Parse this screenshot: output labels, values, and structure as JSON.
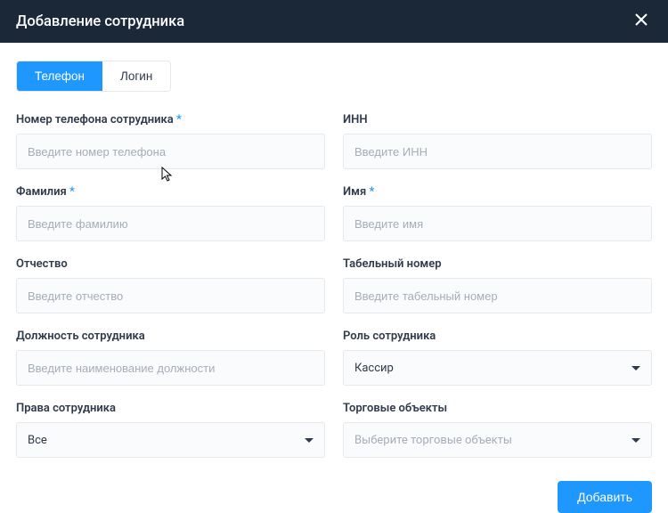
{
  "header": {
    "title": "Добавление сотрудника"
  },
  "tabs": {
    "phone": "Телефон",
    "login": "Логин"
  },
  "fields": {
    "phone": {
      "label": "Номер телефона сотрудника",
      "placeholder": "Введите номер телефона",
      "required": true
    },
    "inn": {
      "label": "ИНН",
      "placeholder": "Введите ИНН",
      "required": false
    },
    "lastname": {
      "label": "Фамилия",
      "placeholder": "Введите фамилию",
      "required": true
    },
    "firstname": {
      "label": "Имя",
      "placeholder": "Введите имя",
      "required": true
    },
    "midname": {
      "label": "Отчество",
      "placeholder": "Введите отчество",
      "required": false
    },
    "tabnum": {
      "label": "Табельный номер",
      "placeholder": "Введите табельный номер",
      "required": false
    },
    "position": {
      "label": "Должность сотрудника",
      "placeholder": "Введите наименование должности",
      "required": false
    },
    "role": {
      "label": "Роль сотрудника",
      "value": "Кассир"
    },
    "rights": {
      "label": "Права сотрудника",
      "value": "Все"
    },
    "objects": {
      "label": "Торговые объекты",
      "placeholder": "Выберите торговые объекты"
    }
  },
  "footer": {
    "submit": "Добавить"
  }
}
